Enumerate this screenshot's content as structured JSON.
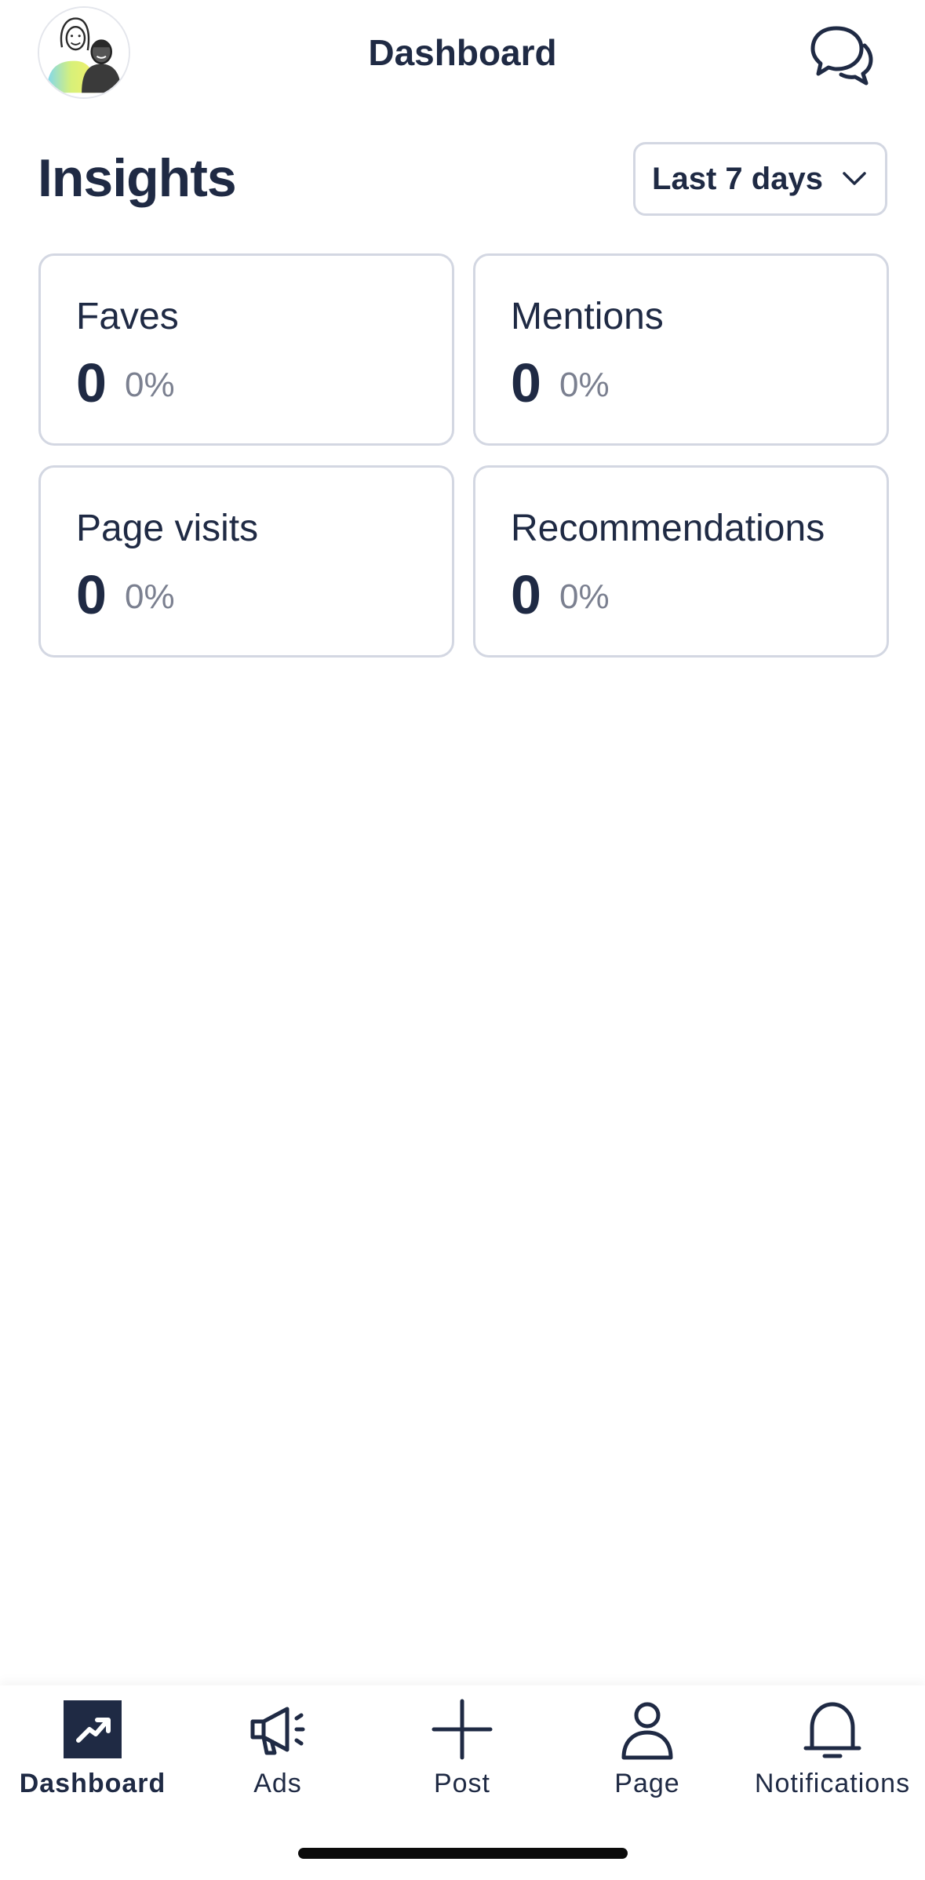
{
  "header": {
    "title": "Dashboard",
    "avatar_icon": "avatar-illustration",
    "messages_icon": "chat-bubbles-icon"
  },
  "insights": {
    "title": "Insights",
    "range": {
      "selected": "Last 7 days",
      "icon": "chevron-down-icon"
    },
    "cards": [
      {
        "label": "Faves",
        "value": "0",
        "change": "0%"
      },
      {
        "label": "Mentions",
        "value": "0",
        "change": "0%"
      },
      {
        "label": "Page visits",
        "value": "0",
        "change": "0%"
      },
      {
        "label": "Recommendations",
        "value": "0",
        "change": "0%"
      }
    ]
  },
  "tabbar": {
    "tabs": [
      {
        "label": "Dashboard",
        "icon": "trend-up-icon",
        "active": true
      },
      {
        "label": "Ads",
        "icon": "megaphone-icon",
        "active": false
      },
      {
        "label": "Post",
        "icon": "plus-icon",
        "active": false
      },
      {
        "label": "Page",
        "icon": "person-icon",
        "active": false
      },
      {
        "label": "Notifications",
        "icon": "bell-icon",
        "active": false
      }
    ]
  },
  "colors": {
    "text_primary": "#1f2a44",
    "text_secondary": "#7b8090",
    "border": "#d3d7e2",
    "active_tab_bg": "#1f2a44"
  }
}
